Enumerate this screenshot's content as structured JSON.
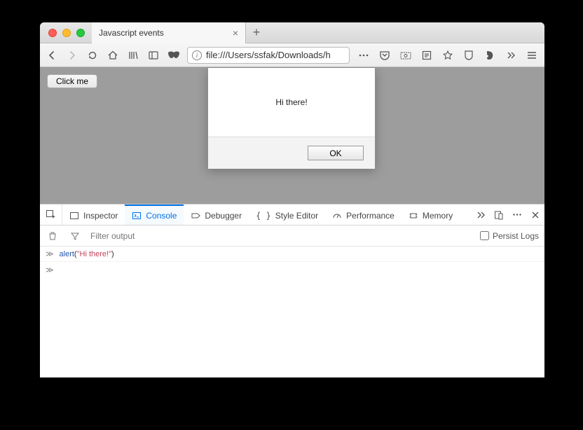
{
  "tab": {
    "title": "Javascript events"
  },
  "url": "file:///Users/ssfak/Downloads/h",
  "page": {
    "button_label": "Click me",
    "alert_message": "Hi there!",
    "alert_ok": "OK"
  },
  "devtools": {
    "tabs": {
      "inspector": "Inspector",
      "console": "Console",
      "debugger": "Debugger",
      "style_editor": "Style Editor",
      "performance": "Performance",
      "memory": "Memory"
    },
    "filter_placeholder": "Filter output",
    "persist_label": "Persist Logs",
    "console_line": {
      "fn": "alert",
      "open": "(",
      "str": "\"Hi there!\"",
      "close": ")"
    }
  }
}
